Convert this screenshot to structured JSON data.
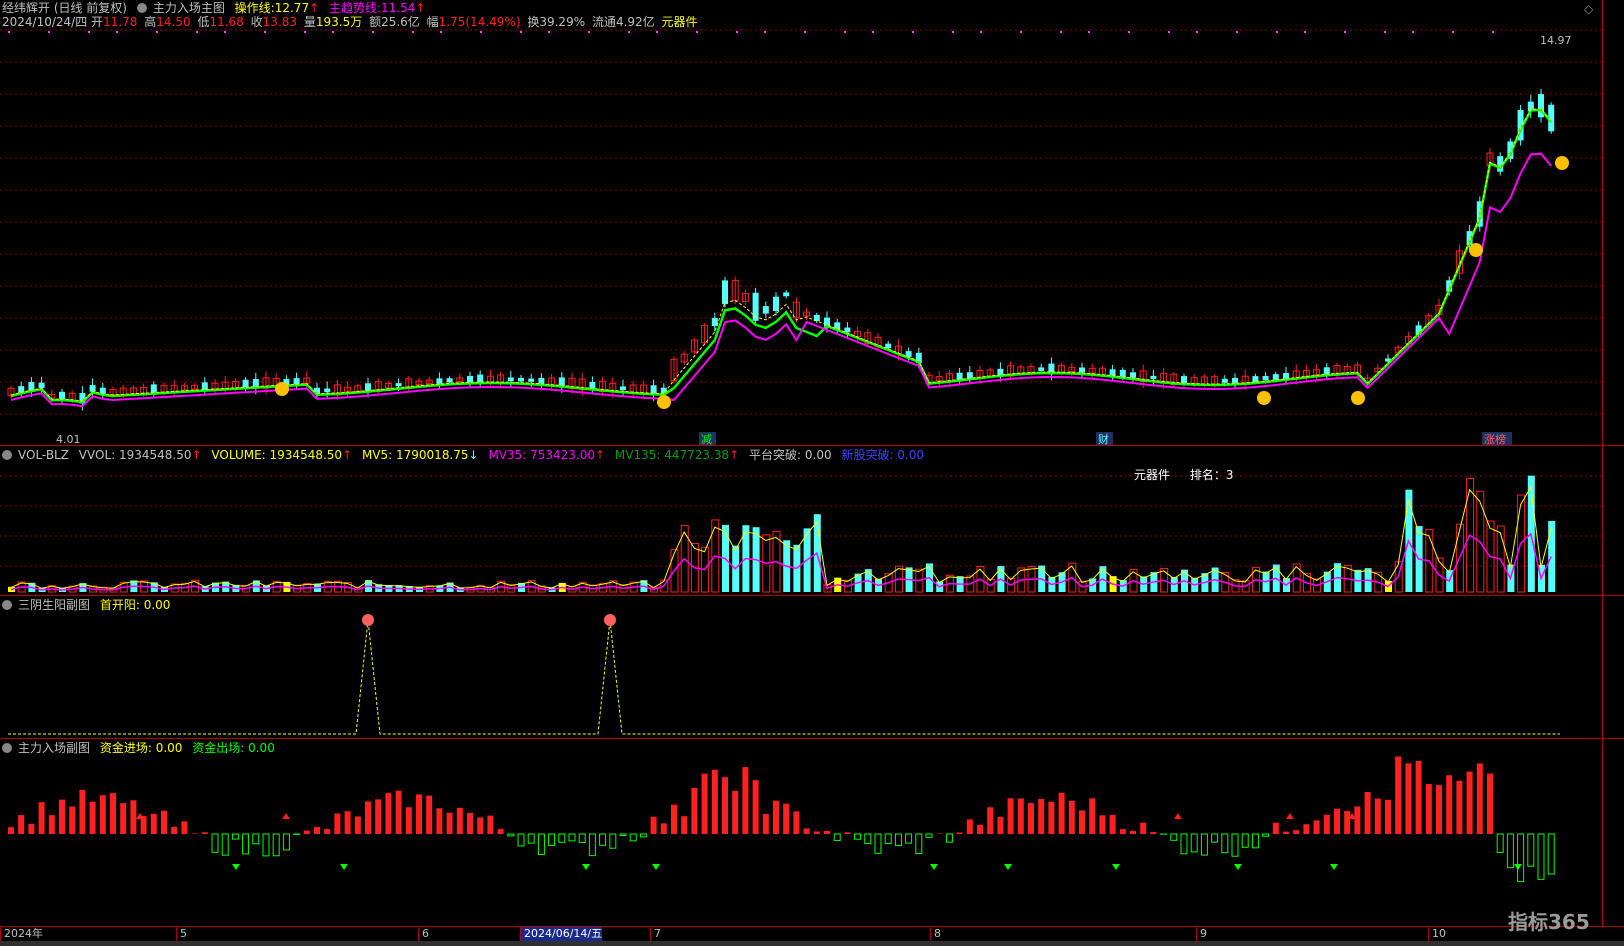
{
  "header_main": {
    "title": "经纬辉开 (日线 前复权)",
    "indicator": "主力入场主图",
    "op_line_label": "操作线:",
    "op_line_value": "12.77",
    "trend_label": "主趋势线:",
    "trend_value": "11.54",
    "up_arrow": "↑",
    "date": "2024/10/24/四",
    "open_label": "开",
    "open": "11.78",
    "high_label": "高",
    "high": "14.50",
    "low_label": "低",
    "low": "11.68",
    "close_label": "收",
    "close": "13.83",
    "volume_label": "量",
    "volume": "193.5万",
    "amount_label": "额",
    "amount": "25.6亿",
    "change_label": "幅",
    "change": "1.75(14.49%)",
    "turnover_label": "换",
    "turnover": "39.29%",
    "float_label": "流通",
    "float": "4.92亿",
    "sector": "元器件"
  },
  "price_marks": {
    "high_mark": "14.97",
    "low_mark": "4.01",
    "events": [
      "减",
      "财",
      "涨榜"
    ]
  },
  "header_vol": {
    "name": "VOL-BLZ",
    "vvol": "VVOL: 1934548.50",
    "volume": "VOLUME: 1934548.50",
    "mv5": "MV5: 1790018.75",
    "mv35": "MV35: 753423.00",
    "mv135": "MV135: 447723.38",
    "platform": "平台突破: 0.00",
    "new_stock": "新股突破: 0.00",
    "sector_label": "元器件",
    "rank_label": "排名：3"
  },
  "header_sub1": {
    "name": "三阴生阳副图",
    "first_open": "首开阳: 0.00"
  },
  "header_sub2": {
    "name": "主力入场副图",
    "fund_in": "资金进场: 0.00",
    "fund_out": "资金出场: 0.00"
  },
  "date_axis": [
    {
      "label": "2024年",
      "selected": false
    },
    {
      "label": "5",
      "selected": false
    },
    {
      "label": "6",
      "selected": false
    },
    {
      "label": "2024/06/14/五",
      "selected": true
    },
    {
      "label": "7",
      "selected": false
    },
    {
      "label": "8",
      "selected": false
    },
    {
      "label": "9",
      "selected": false
    },
    {
      "label": "10",
      "selected": false
    }
  ],
  "brand": "指标365",
  "colors": {
    "up": "#ff2020",
    "down": "#54ffff",
    "trend": "#ff00ff",
    "green_line": "#00ff00",
    "yellow": "#ffff00",
    "grid": "#8b0000"
  }
}
